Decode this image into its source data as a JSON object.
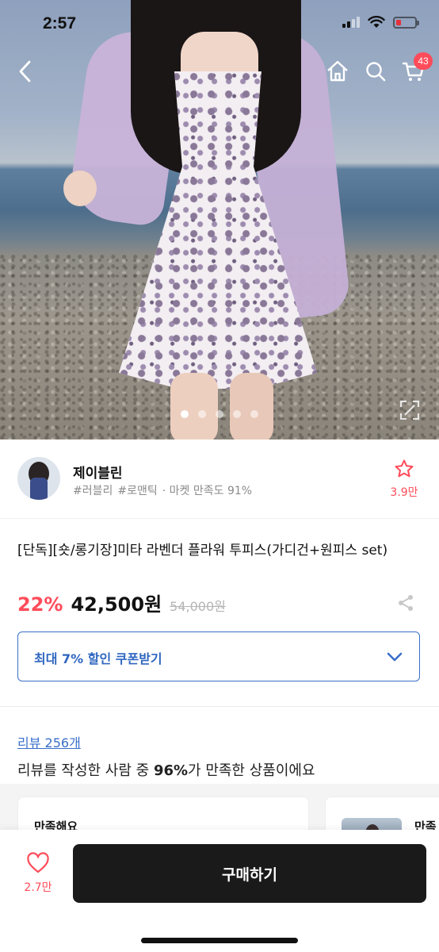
{
  "status_bar": {
    "time": "2:57"
  },
  "header": {
    "cart_count": "43"
  },
  "carousel": {
    "total": 5,
    "active": 1
  },
  "seller": {
    "name": "제이블린",
    "tags": [
      "#러블리",
      "#로맨틱"
    ],
    "satisfaction": "· 마켓 만족도 91%",
    "favorite_count": "3.9만"
  },
  "product": {
    "title": "[단독][숏/롱기장]미타 라벤더 플라워 투피스(가디건+원피스 set)",
    "discount": "22%",
    "price": "42,500원",
    "original_price": "54,000원"
  },
  "coupon": {
    "label": "최대 7% 할인 쿠폰받기"
  },
  "reviews": {
    "link": "리뷰 256개",
    "summary_prefix": "리뷰를 작성한 사람 중 ",
    "summary_percent": "96%",
    "summary_suffix": "가 만족한 상품이에요",
    "cards": [
      {
        "label": "만족해요"
      },
      {
        "label": "만족"
      }
    ]
  },
  "bottom_bar": {
    "like_count": "2.7만",
    "buy_label": "구매하기"
  },
  "colors": {
    "accent_red": "#ff4c5a",
    "link_blue": "#3a6fc9",
    "buy_button": "#1a1a1a"
  }
}
